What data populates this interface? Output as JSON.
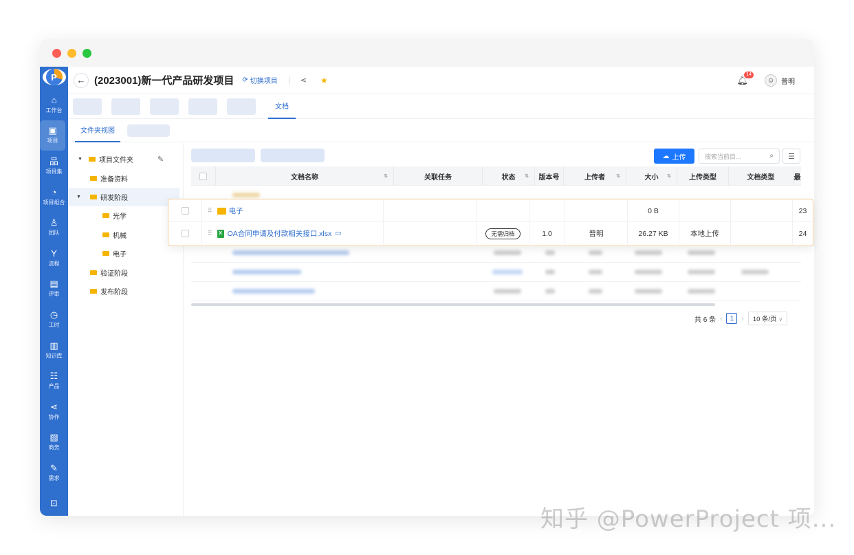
{
  "header": {
    "title": "(2023001)新一代产品研发项目",
    "switch_label": "切换项目",
    "notification_count": "14",
    "user_name": "普明"
  },
  "sidebar": {
    "items": [
      {
        "label": "工作台",
        "icon": "home-icon",
        "glyph": "⌂"
      },
      {
        "label": "项目",
        "icon": "project-icon",
        "glyph": "▣",
        "active": true
      },
      {
        "label": "项目集",
        "icon": "program-icon",
        "glyph": "品"
      },
      {
        "label": "项目组合",
        "icon": "portfolio-icon",
        "glyph": "◔"
      },
      {
        "label": "团队",
        "icon": "team-icon",
        "glyph": "♙"
      },
      {
        "label": "流程",
        "icon": "flow-icon",
        "glyph": "Y"
      },
      {
        "label": "评审",
        "icon": "review-icon",
        "glyph": "▤"
      },
      {
        "label": "工时",
        "icon": "clock-icon",
        "glyph": "◷"
      },
      {
        "label": "知识库",
        "icon": "book-icon",
        "glyph": "▥"
      },
      {
        "label": "产品",
        "icon": "product-icon",
        "glyph": "☷"
      },
      {
        "label": "协作",
        "icon": "share-icon",
        "glyph": "⋖"
      },
      {
        "label": "商务",
        "icon": "business-icon",
        "glyph": "▧"
      },
      {
        "label": "需求",
        "icon": "requirement-icon",
        "glyph": "✎"
      },
      {
        "label": "",
        "icon": "terminal-icon",
        "glyph": "⊡"
      }
    ]
  },
  "tabs": {
    "active_label": "文档"
  },
  "subtabs": {
    "active_label": "文件夹视图"
  },
  "tree": {
    "root": "项目文件夹",
    "items": [
      {
        "label": "准备资料",
        "level": 1
      },
      {
        "label": "研发阶段",
        "level": 1,
        "expanded": true,
        "selected": true
      },
      {
        "label": "光学",
        "level": 2
      },
      {
        "label": "机械",
        "level": 2
      },
      {
        "label": "电子",
        "level": 2
      },
      {
        "label": "验证阶段",
        "level": 1
      },
      {
        "label": "发布阶段",
        "level": 1
      }
    ]
  },
  "toolbar": {
    "upload_label": "上传",
    "search_placeholder": "搜索当前目..."
  },
  "table": {
    "columns": [
      "文档名称",
      "关联任务",
      "状态",
      "版本号",
      "上传者",
      "大小",
      "上传类型",
      "文档类型",
      "最"
    ],
    "rows": [
      {
        "name": "电子",
        "type": "folder",
        "task": "",
        "status": "",
        "version": "",
        "uploader": "",
        "size": "0 B",
        "upload_type": "",
        "doc_type": "",
        "last": "23"
      },
      {
        "name": "OA合同申请及付款相关接口.xlsx",
        "type": "xlsx",
        "task": "",
        "status": "无需归档",
        "version": "1.0",
        "uploader": "普明",
        "size": "26.27 KB",
        "upload_type": "本地上传",
        "doc_type": "",
        "last": "24"
      }
    ]
  },
  "pagination": {
    "total": "共 6 条",
    "current": "1",
    "page_size": "10 条/页"
  },
  "watermark": "知乎 @PowerProject 项..."
}
